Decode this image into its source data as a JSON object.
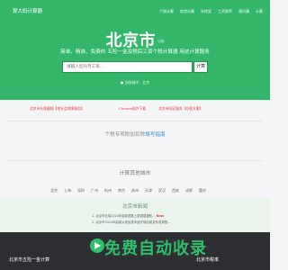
{
  "brand": {
    "name": "算大妈计算器"
  },
  "nav": [
    "个税计算",
    "房贷计算",
    "年终奖",
    "工资税率",
    "通讯簿",
    "计算"
  ],
  "hero": {
    "city": "北京市",
    "city_sub": "切换",
    "slogan": "简单、精准、免费的 五险一金及税后工资个税计算器 用这计算服务",
    "search_placeholder": "请输入您的月工资...",
    "search_button": "计算",
    "location_text": "当前城市：北京"
  },
  "promo": {
    "left": "北京市社保缴纳【地社会保障服务】",
    "middle": "Chrome插件下载",
    "right": "北京市网证服务【办理方案】"
  },
  "favorites": {
    "text": "个税专项附加扣除",
    "link": "填写指南"
  },
  "other_cities": {
    "title": "计算其他城市",
    "items": [
      "北京",
      "上海",
      "深圳",
      "广州",
      "杭州",
      "南京",
      "苏州",
      "天津",
      "武汉",
      "西安",
      "成都",
      "重庆"
    ]
  },
  "news": {
    "title": "北京市新闻",
    "items": [
      {
        "text": "1. 北京市社保2024年缴费基数上限调整通知…",
        "badge": "New"
      },
      {
        "text": "2. 北京市2024年起城乡居民基本医疗保险缴费标准调整…",
        "badge": ""
      }
    ]
  },
  "footer": {
    "col1": "北京市五险一金计算",
    "col2": "北京市税率"
  },
  "watermark": {
    "text": "免费自动收录"
  },
  "colors": {
    "primary": "#34b76a",
    "accent_red": "#e8373c",
    "link": "#3a89c9",
    "footer": "#2d2f33"
  }
}
